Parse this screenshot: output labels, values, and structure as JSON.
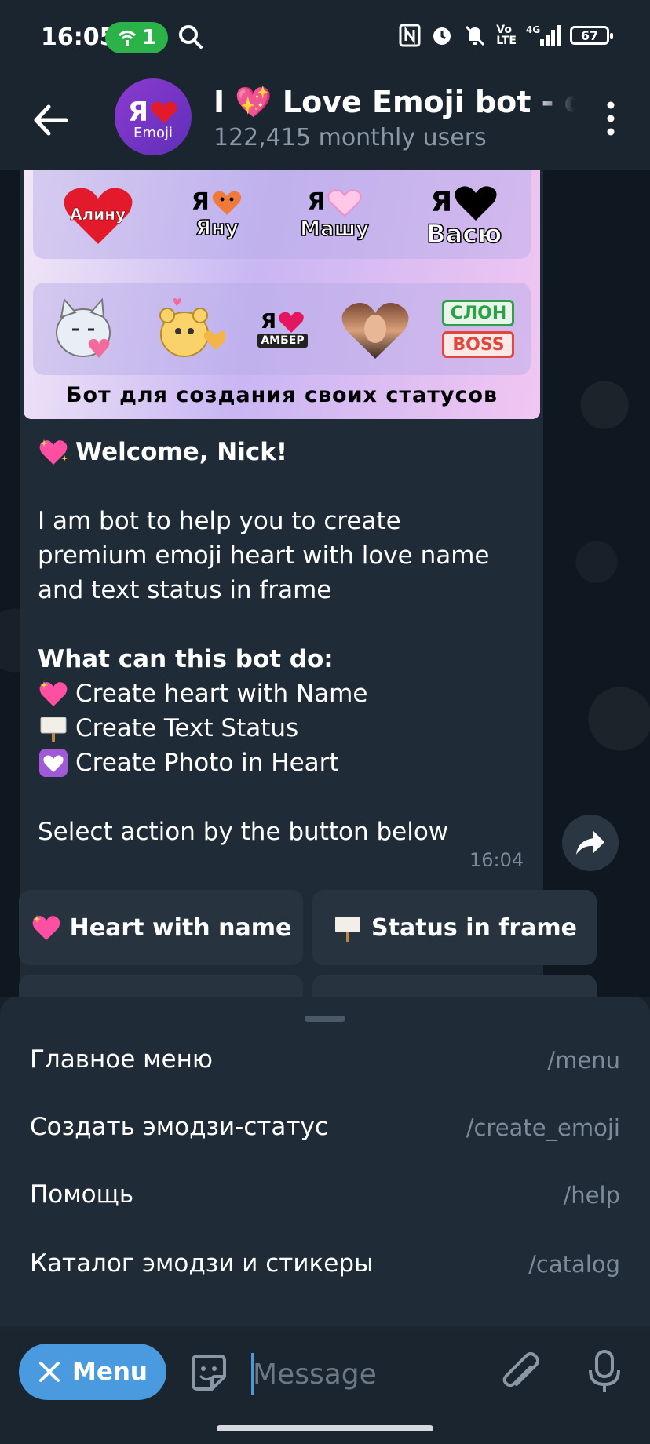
{
  "status_bar": {
    "time": "16:05",
    "hotspot_count": "1",
    "battery": "67",
    "icons": [
      "search-icon",
      "nfc-icon",
      "alarm-icon",
      "mute-icon",
      "volte-icon",
      "signal-4g-icon",
      "battery-icon"
    ]
  },
  "header": {
    "title": "I 💖 Love Emoji bot - cos",
    "subtitle": "122,415 monthly users",
    "avatar_top": "Я",
    "avatar_label": "Emoji"
  },
  "banner": {
    "row1": [
      {
        "ya": "",
        "name": "Алину"
      },
      {
        "ya": "Я",
        "name": "Яну"
      },
      {
        "ya": "Я",
        "name": "Машу"
      },
      {
        "ya": "Я",
        "name": "Васю"
      }
    ],
    "row2": {
      "amber_ya": "Я",
      "amber_name": "АМБЕР",
      "slon": "СЛОН",
      "boss": "BOSS"
    },
    "caption": "Бот для создания своих статусов"
  },
  "message": {
    "greeting": "Welcome, Nick!",
    "intro_lines": [
      "I am bot to help you to create",
      "premium emoji heart with love name",
      "and text status in frame"
    ],
    "what_title": "What can this bot do:",
    "features": [
      "Create heart with Name",
      "Create Text Status",
      "Create Photo in Heart"
    ],
    "footer": "Select action by the button below",
    "time": "16:04"
  },
  "keyboard": {
    "b1": "Heart with name",
    "b2": "Status in frame"
  },
  "commands": [
    {
      "name": "Главное меню",
      "cmd": "/menu"
    },
    {
      "name": "Создать эмодзи-статус",
      "cmd": "/create_emoji"
    },
    {
      "name": "Помощь",
      "cmd": "/help"
    },
    {
      "name": "Каталог эмодзи и стикеры",
      "cmd": "/catalog"
    }
  ],
  "input": {
    "menu_label": "Menu",
    "placeholder": "Message"
  },
  "colors": {
    "accent": "#4a9ae0",
    "background": "#0f1820",
    "bubble": "#1f2b37",
    "hotspot": "#2bb34a"
  }
}
